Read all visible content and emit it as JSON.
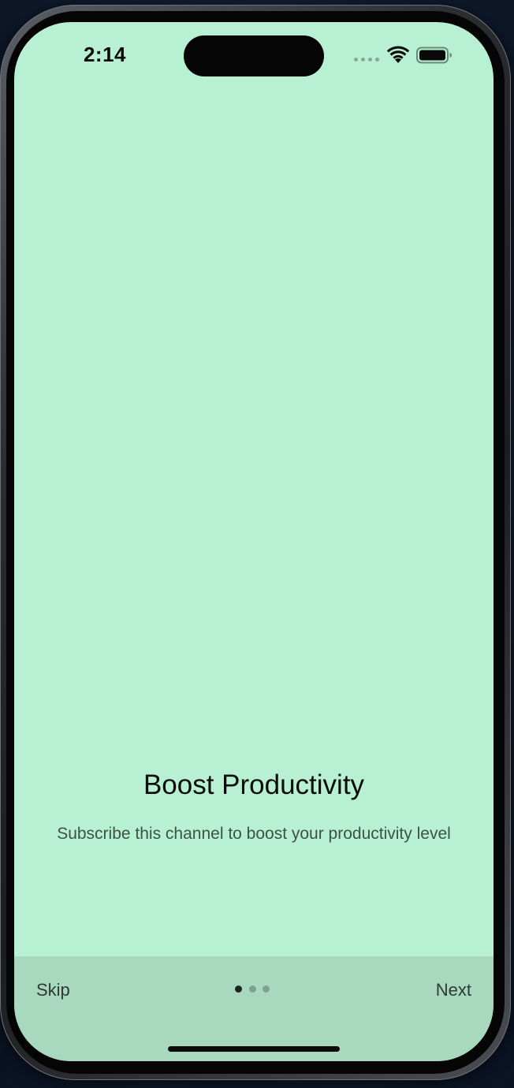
{
  "status_bar": {
    "time": "2:14",
    "icons": [
      "cellular-signal-icon",
      "wifi-icon",
      "battery-icon"
    ]
  },
  "onboarding": {
    "title": "Boost Productivity",
    "subtitle": "Subscribe this channel to boost your productivity level",
    "background_color": "#b8f0d3"
  },
  "footer": {
    "skip_label": "Skip",
    "next_label": "Next",
    "page_count": 3,
    "current_page": 1,
    "background_color": "#a8d9be"
  }
}
